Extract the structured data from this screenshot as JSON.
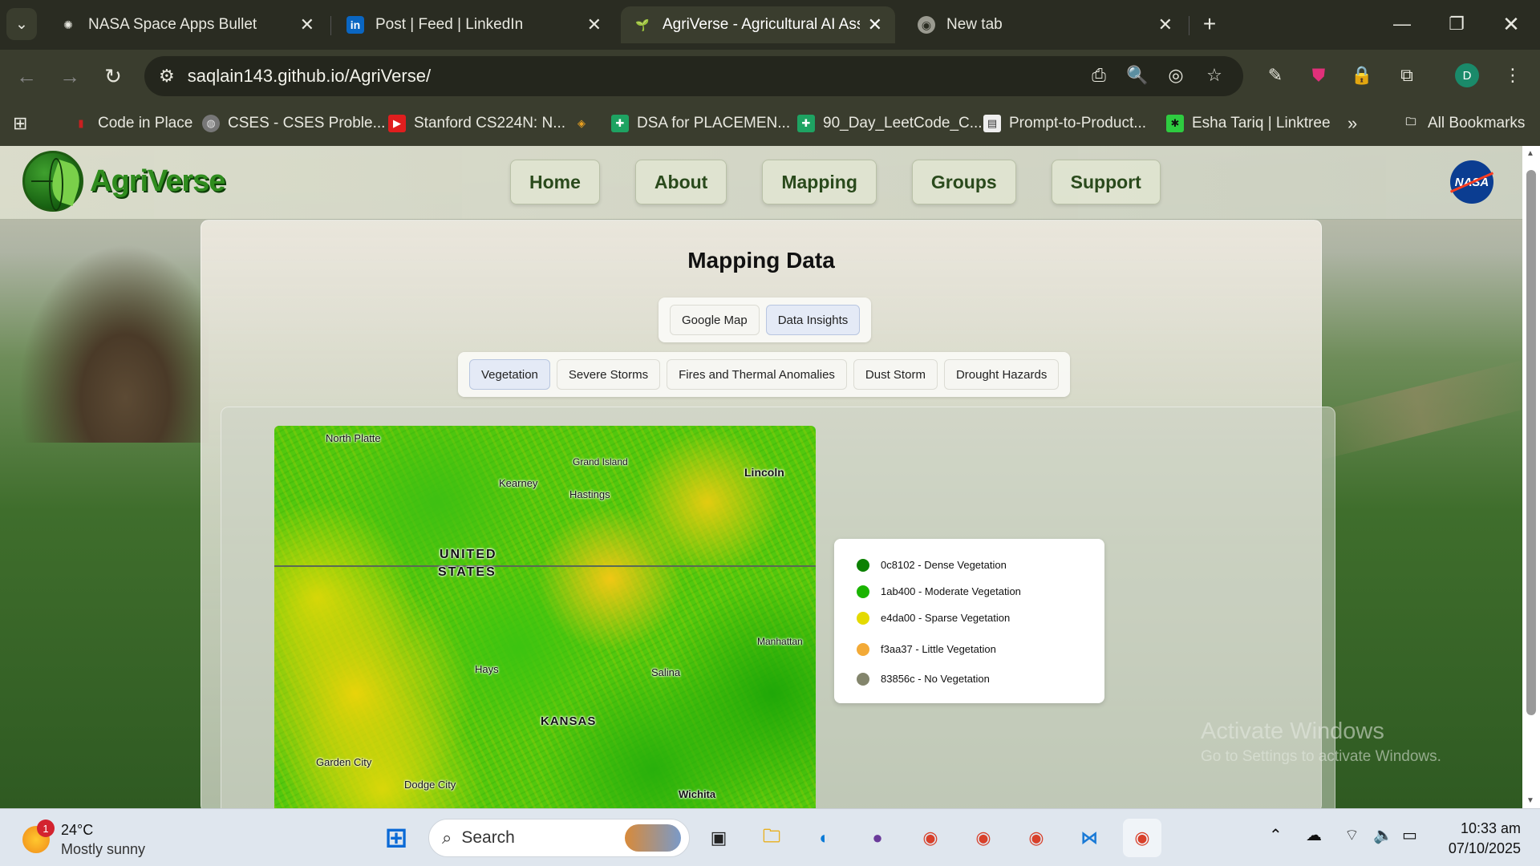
{
  "browser": {
    "tabs": [
      {
        "title": "NASA Space Apps Bullet",
        "icon": "openai-icon"
      },
      {
        "title": "Post | Feed | LinkedIn",
        "icon": "linkedin-icon"
      },
      {
        "title": "AgriVerse - Agricultural AI Assis",
        "icon": "agriverse-icon",
        "active": true
      },
      {
        "title": "New tab",
        "icon": "chrome-icon"
      }
    ],
    "url": "saqlain143.github.io/AgriVerse/",
    "profile_initial": "D",
    "bookmarks": [
      {
        "label": "Code in Place"
      },
      {
        "label": "CSES - CSES Proble..."
      },
      {
        "label": "Stanford CS224N: N..."
      },
      {
        "label": ""
      },
      {
        "label": "DSA for PLACEMEN..."
      },
      {
        "label": "90_Day_LeetCode_C..."
      },
      {
        "label": "Prompt-to-Product..."
      },
      {
        "label": "Esha Tariq | Linktree"
      }
    ],
    "more_bookmarks": "»",
    "all_bookmarks": "All Bookmarks"
  },
  "site": {
    "brand": "AgriVerse",
    "nav": [
      "Home",
      "About",
      "Mapping",
      "Groups",
      "Support"
    ],
    "nasa_logo": "NASA"
  },
  "mapping": {
    "title": "Mapping Data",
    "view_toggle": [
      "Google Map",
      "Data Insights"
    ],
    "view_selected": "Data Insights",
    "layers": [
      "Vegetation",
      "Severe Storms",
      "Fires and Thermal Anomalies",
      "Dust Storm",
      "Drought Hazards"
    ],
    "layer_selected": "Vegetation",
    "map_labels": {
      "north_platte": "North Platte",
      "grand_island": "Grand Island",
      "kearney": "Kearney",
      "lincoln": "Lincoln",
      "hastings": "Hastings",
      "united": "UNITED",
      "states": "STATES",
      "manhattan": "Manhattan",
      "hays": "Hays",
      "salina": "Salina",
      "kansas": "KANSAS",
      "garden_city": "Garden City",
      "dodge_city": "Dodge City",
      "wichita": "Wichita"
    },
    "legend": [
      {
        "label": "0c8102 - Dense Vegetation",
        "color": "#0c8102"
      },
      {
        "label": "1ab400 - Moderate Vegetation",
        "color": "#1ab400"
      },
      {
        "label": "e4da00 - Sparse Vegetation",
        "color": "#e4da00"
      },
      {
        "label": "f3aa37 - Little Vegetation",
        "color": "#f3aa37"
      },
      {
        "label": "83856c - No Vegetation",
        "color": "#83856c"
      }
    ]
  },
  "watermark": {
    "line1": "Activate Windows",
    "line2": "Go to Settings to activate Windows."
  },
  "taskbar": {
    "weather_temp": "24°C",
    "weather_desc": "Mostly sunny",
    "weather_badge": "1",
    "search_placeholder": "Search",
    "time": "10:33 am",
    "date": "07/10/2025"
  }
}
